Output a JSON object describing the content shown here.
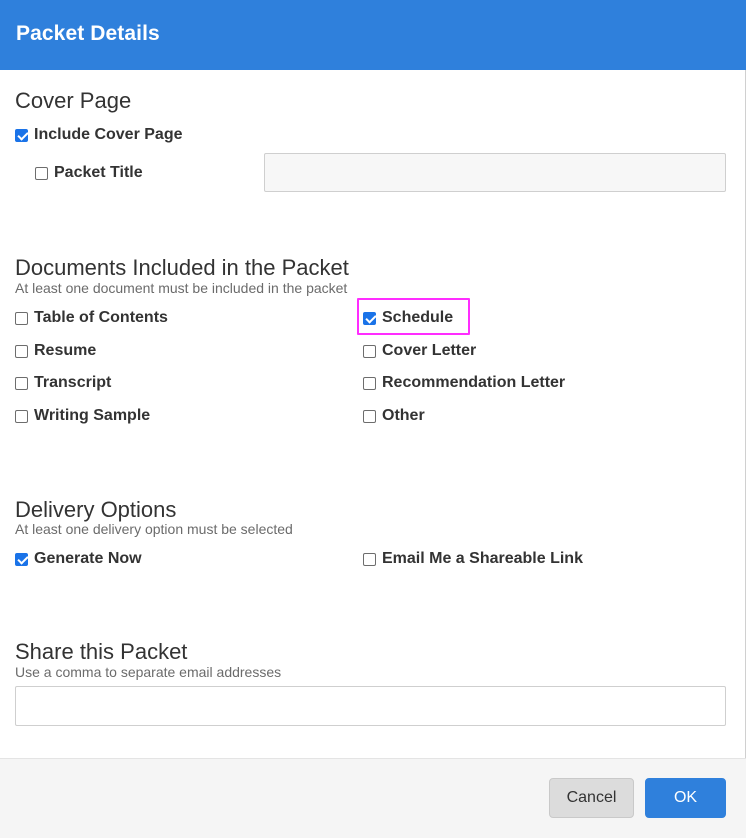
{
  "header": {
    "title": "Packet Details"
  },
  "cover_page": {
    "title": "Cover Page",
    "include_cover_page": {
      "label": "Include Cover Page",
      "checked": true
    },
    "packet_title": {
      "label": "Packet Title",
      "checked": false,
      "value": "",
      "placeholder": ""
    }
  },
  "documents": {
    "title": "Documents Included in the Packet",
    "note": "At least one document must be included in the packet",
    "items": [
      {
        "label": "Table of Contents",
        "checked": false
      },
      {
        "label": "Schedule",
        "checked": true
      },
      {
        "label": "Resume",
        "checked": false
      },
      {
        "label": "Cover Letter",
        "checked": false
      },
      {
        "label": "Transcript",
        "checked": false
      },
      {
        "label": "Recommendation Letter",
        "checked": false
      },
      {
        "label": "Writing Sample",
        "checked": false
      },
      {
        "label": "Other",
        "checked": false
      }
    ]
  },
  "delivery": {
    "title": "Delivery Options",
    "note": "At least one delivery option must be selected",
    "items": [
      {
        "label": "Generate Now",
        "checked": true
      },
      {
        "label": "Email Me a Shareable Link",
        "checked": false
      }
    ]
  },
  "share": {
    "title": "Share this Packet",
    "note": "Use a comma to separate email addresses",
    "value": "",
    "placeholder": ""
  },
  "footer": {
    "cancel_label": "Cancel",
    "ok_label": "OK"
  },
  "colors": {
    "header": "#2f80dc",
    "checkbox_checked": "#1a73e8",
    "highlight": "#ff2dff",
    "ok_button": "#2f80dc",
    "cancel_button": "#dcdcdc"
  }
}
